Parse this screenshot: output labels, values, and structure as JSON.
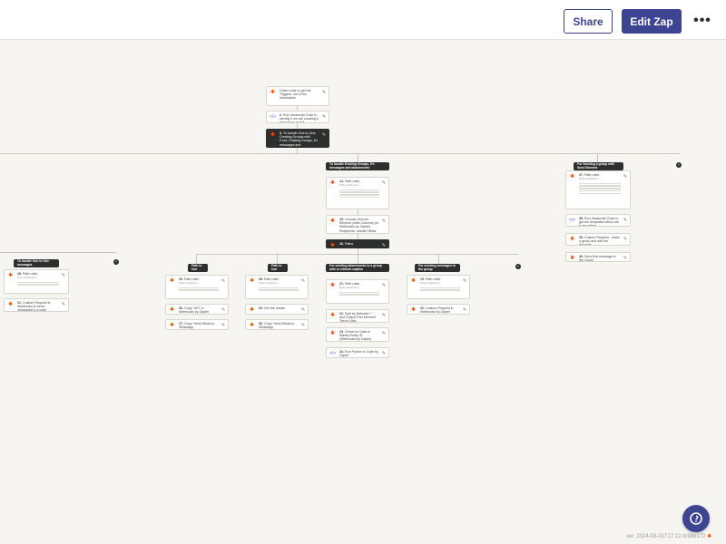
{
  "toolbar": {
    "share_label": "Share",
    "edit_label": "Edit Zap",
    "more_label": "•••"
  },
  "colors": {
    "brand": "#3d4592",
    "accent": "#ff4f00",
    "canvas": "#f6f5f2"
  },
  "steps": {
    "s_top1": {
      "title": "Catch route to get the Triggers, out of the information"
    },
    "s_top2": {
      "num": "2.",
      "title": "Run Javascript Code to identify if we are creating a new group or not"
    },
    "s_main": {
      "num": "3.",
      "title": "To handle One-to-One, Creating Groups with Front, Existing Groups, it's messages and attachments..."
    },
    "s_path_a": {
      "num": "14.",
      "title": "Path rules",
      "sub": "Only continue if..."
    },
    "s_a2": {
      "num": "15.",
      "title": "Choose Second Element (After Comma) (in Webhooks by Zapier) Recipients: handle Fields"
    },
    "s_paths": {
      "num": "16.",
      "title": "Paths"
    },
    "s_left1": {
      "num": "28.",
      "title": "Path rules",
      "sub": "Only continue if..."
    },
    "s_left2": {
      "num": "31.",
      "title": "Custom Request in Webhooks to send messages to a code"
    },
    "s_p1a": {
      "num": "25.",
      "title": "Path rules",
      "sub": "Only continue if..."
    },
    "s_p1b": {
      "num": "26.",
      "title": "Copy: GET in Webhooks by Zapier"
    },
    "s_p1c": {
      "num": "27.",
      "title": "Copy: Send Media in Whatsapp"
    },
    "s_p2a": {
      "num": "28.",
      "title": "Path rules",
      "sub": "Only continue if..."
    },
    "s_p2b": {
      "num": "29.",
      "title": "Get the media"
    },
    "s_p2c": {
      "num": "30.",
      "title": "Copy: Send Media in Whatsapp"
    },
    "s_p3a": {
      "num": "21.",
      "title": "Path rules",
      "sub": "Only continue if..."
    },
    "s_p3b": {
      "num": "22.",
      "title": "Split by Delimiter \"-\" and Output First Element Text in Utils"
    },
    "s_p3c": {
      "num": "23.",
      "title": "Check for Data in Wasby Entity ID (Webhooks by Zapier) \"Text\" field"
    },
    "s_p3d": {
      "num": "24.",
      "title": "Run Python in Code by Zapier"
    },
    "s_p4a": {
      "num": "19.",
      "title": "Path rules",
      "sub": "Only continue if..."
    },
    "s_p4b": {
      "num": "20.",
      "title": "Custom Request in Webhooks by Zapier"
    },
    "s_r1": {
      "num": "37.",
      "title": "Path rules",
      "sub": "Only continue if..."
    },
    "s_r2": {
      "num": "38.",
      "title": "Run Javascript Code to get the templates which are to be edited"
    },
    "s_r3": {
      "num": "39.",
      "title": "Custom Request - make a group and add the template"
    },
    "s_r4": {
      "num": "40.",
      "title": "Send first message in the Group"
    }
  },
  "path_labels": {
    "center": "To handle Existing Groups, it's messages and attachments",
    "right": "For Sending a group with Send Element",
    "left": "To handle One to One messages",
    "p1": "Path to Use",
    "p2": "Path to Use",
    "p3": "For sending attachments to a group with or without caption",
    "p4": "For sending messages to the group"
  },
  "version": "ver. 2024-03-01T17:12-fc99d172"
}
